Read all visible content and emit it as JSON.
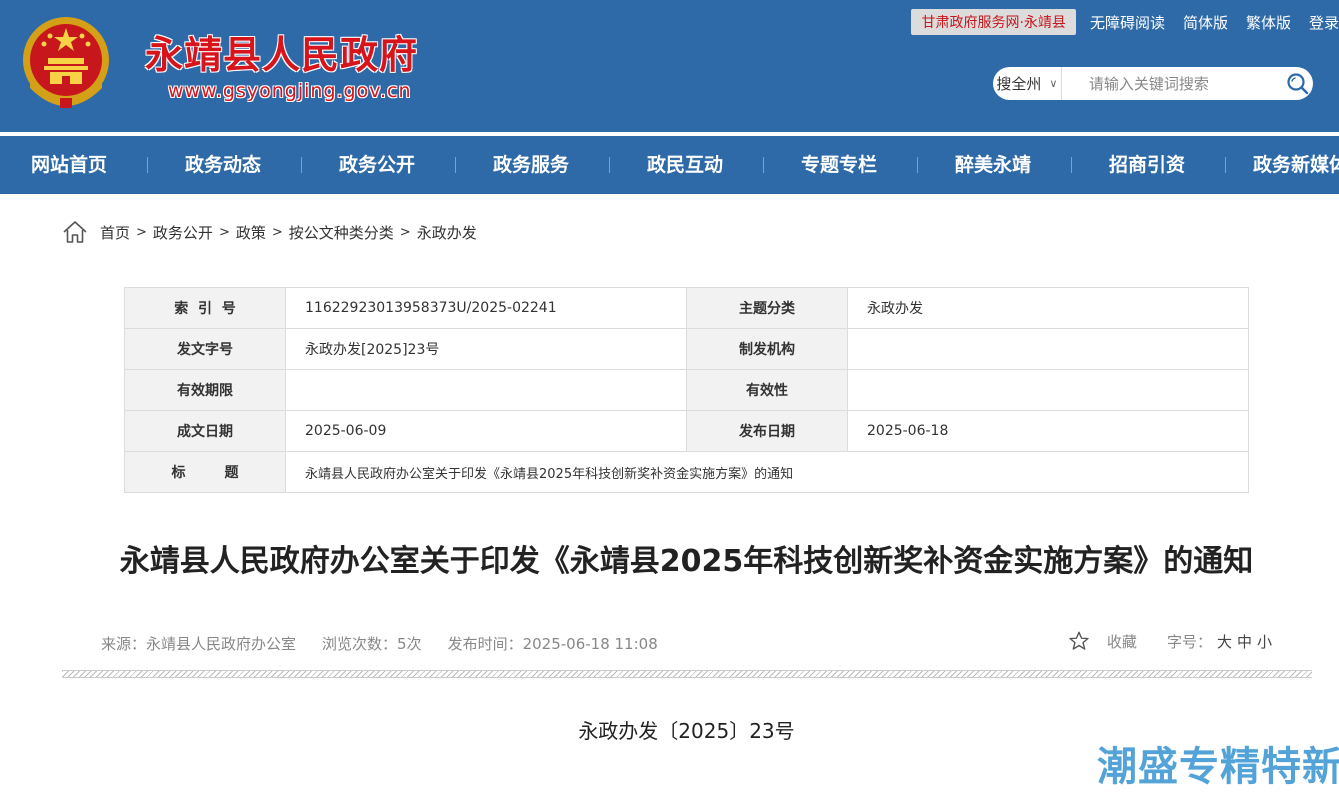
{
  "header": {
    "site_title": "永靖县人民政府",
    "site_url": "www.gsyongjing.gov.cn",
    "top_links": {
      "gansu_portal": "甘肃政府服务网·永靖县",
      "accessible": "无障碍阅读",
      "simplified": "简体版",
      "traditional": "繁体版",
      "login": "登录"
    },
    "search": {
      "scope": "搜全州",
      "placeholder": "请输入关键词搜索"
    }
  },
  "nav": [
    "网站首页",
    "政务动态",
    "政务公开",
    "政务服务",
    "政民互动",
    "专题专栏",
    "醉美永靖",
    "招商引资",
    "政务新媒体"
  ],
  "breadcrumb": [
    "首页",
    "政务公开",
    "政策",
    "按公文种类分类",
    "永政办发"
  ],
  "info": {
    "index_label": "索  引  号",
    "index_value": "11622923013958373U/2025-02241",
    "topic_label": "主题分类",
    "topic_value": "永政办发",
    "doc_no_label": "发文字号",
    "doc_no_value": "永政办发[2025]23号",
    "issuer_label": "制发机构",
    "issuer_value": "",
    "validity_period_label": "有效期限",
    "validity_period_value": "",
    "validity_label": "有效性",
    "validity_value": "",
    "written_date_label": "成文日期",
    "written_date_value": "2025-06-09",
    "publish_date_label": "发布日期",
    "publish_date_value": "2025-06-18",
    "title_label": "标        题",
    "title_value": "永靖县人民政府办公室关于印发《永靖县2025年科技创新奖补资金实施方案》的通知"
  },
  "article": {
    "title": "永靖县人民政府办公室关于印发《永靖县2025年科技创新奖补资金实施方案》的通知",
    "source": "来源：永靖县人民政府办公室",
    "views": "浏览次数：5次",
    "publish_time": "发布时间：2025-06-18 11:08",
    "favorite": "收藏",
    "font_size_label": "字号：",
    "font_size_options": [
      "大",
      "中",
      "小"
    ],
    "doc_number": "永政办发〔2025〕23号"
  },
  "watermark": "潮盛专精特新",
  "colors": {
    "header_blue": "#2e6aa8",
    "title_red": "#d7141c",
    "watermark_blue": "#4a9fd6"
  }
}
